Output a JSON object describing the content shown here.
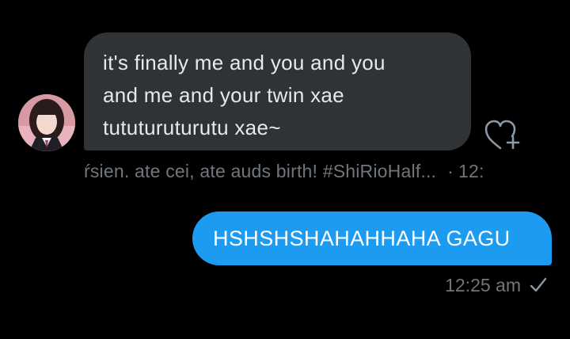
{
  "conversation": {
    "incoming": {
      "message": "it's finally me and you and you\nand me and your twin xae\ntututuruturutu xae~",
      "meta_name": "ŕsien. ate cei, ate auds birth! #ShiRioHalf...",
      "meta_separator": "·",
      "meta_time": "12:"
    },
    "outgoing": {
      "message": "HSHSHSHAHAHHAHA GAGU",
      "time": "12:25 am"
    }
  },
  "icons": {
    "reaction": "heart-plus-icon",
    "read_status": "checkmark-icon"
  },
  "colors": {
    "background": "#000000",
    "incoming_bubble": "#2f3336",
    "outgoing_bubble": "#1d9bf0",
    "meta_text": "#71767b"
  }
}
